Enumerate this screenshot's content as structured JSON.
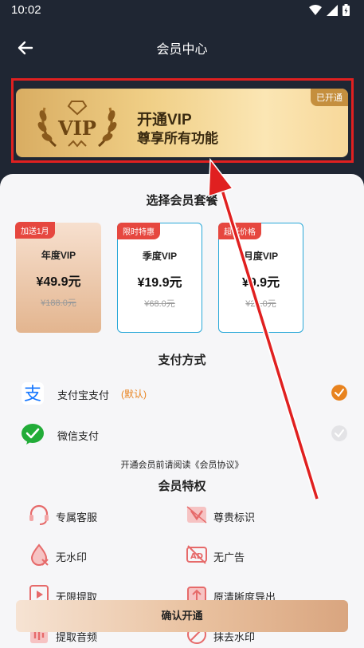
{
  "status_bar": {
    "time": "10:02"
  },
  "nav": {
    "title": "会员中心"
  },
  "banner": {
    "line1": "开通VIP",
    "line2": "尊享所有功能",
    "badge": "已开通",
    "logo_text": "VIP"
  },
  "sections": {
    "plans": "选择会员套餐",
    "payment": "支付方式",
    "benefits": "会员特权"
  },
  "plans": [
    {
      "tag": "加送1月",
      "name": "年度VIP",
      "price": "¥49.9元",
      "original": "¥188.0元",
      "selected": true
    },
    {
      "tag": "限时特惠",
      "name": "季度VIP",
      "price": "¥19.9元",
      "original": "¥68.0元",
      "selected": false
    },
    {
      "tag": "超低价格",
      "name": "月度VIP",
      "price": "¥9.9元",
      "original": "¥28.0元",
      "selected": false
    }
  ],
  "payment": [
    {
      "label": "支付宝支付",
      "default_label": "(默认)",
      "icon": "alipay-icon",
      "selected": true
    },
    {
      "label": "微信支付",
      "default_label": "",
      "icon": "wechat-pay-icon",
      "selected": false
    }
  ],
  "agreement": "开通会员前请阅读《会员协议》",
  "benefits": [
    {
      "label": "专属客服",
      "icon": "headset-icon"
    },
    {
      "label": "尊贵标识",
      "icon": "vip-badge-icon"
    },
    {
      "label": "无水印",
      "icon": "no-watermark-icon"
    },
    {
      "label": "无广告",
      "icon": "no-ads-icon"
    },
    {
      "label": "无限提取",
      "icon": "extract-icon"
    },
    {
      "label": "原清晰度导出",
      "icon": "export-icon"
    },
    {
      "label": "提取音频",
      "icon": "audio-icon"
    },
    {
      "label": "抹去水印",
      "icon": "erase-icon"
    }
  ],
  "confirm": {
    "label": "确认开通"
  },
  "colors": {
    "accent": "#e8831f",
    "tag_red": "#e6473f",
    "header_bg": "#1f2633",
    "annotation_red": "#e02020"
  }
}
